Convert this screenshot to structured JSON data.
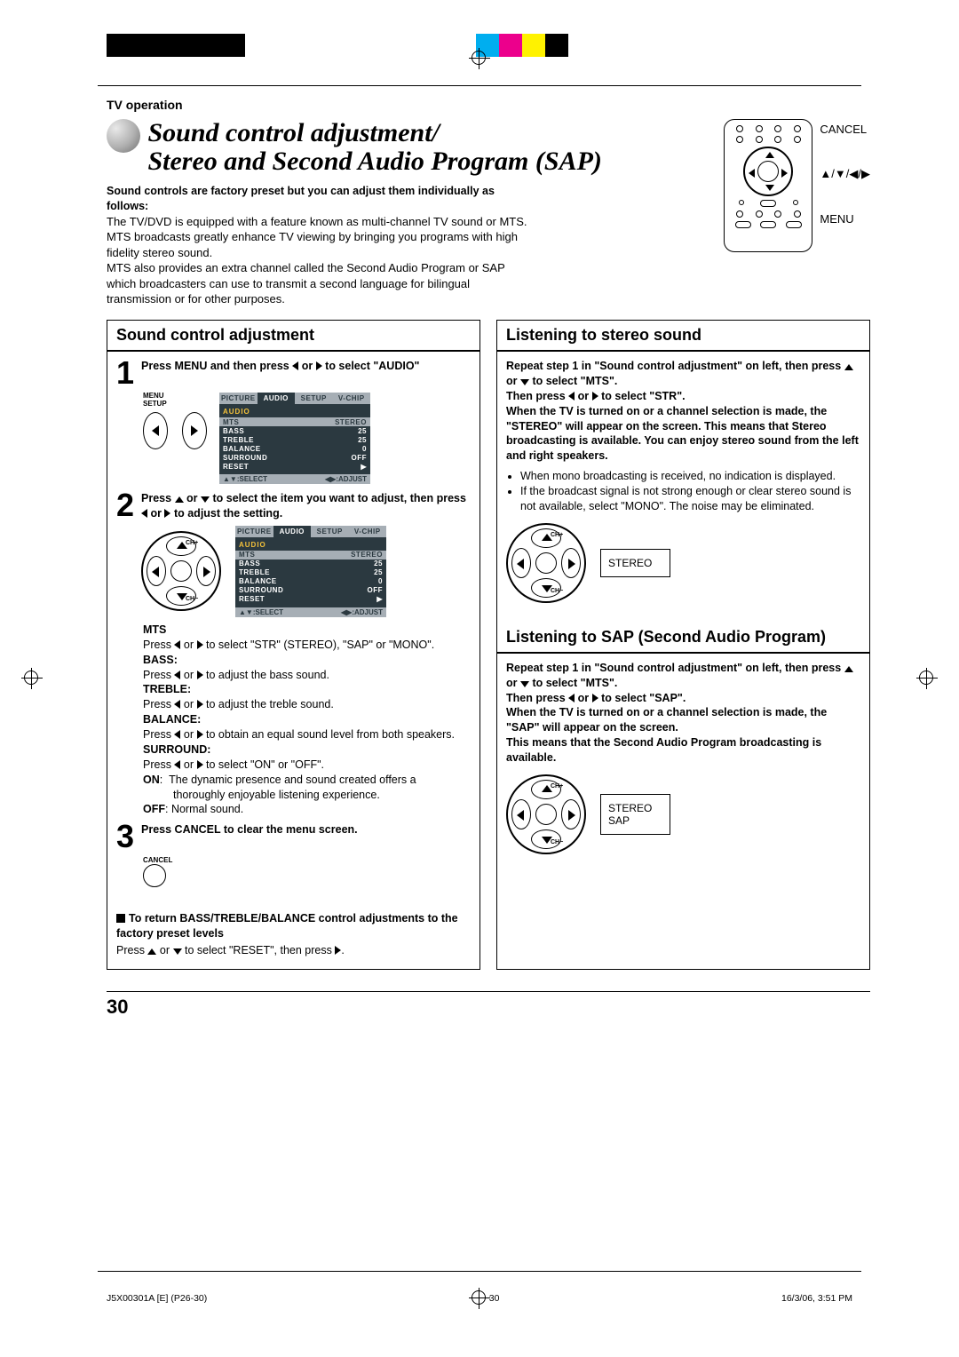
{
  "colorbar": [
    "#000",
    "#000",
    "#000",
    "#000",
    "#000",
    "#000"
  ],
  "colorbar2": [
    "#00aeef",
    "#ec008c",
    "#fff200",
    "#000000"
  ],
  "section_header": "TV operation",
  "title_line1": "Sound control adjustment/",
  "title_line2": "Stereo and Second Audio Program (SAP)",
  "remote_labels": {
    "cancel": "CANCEL",
    "arrows": "▲/▼/◀/▶",
    "menu": "MENU"
  },
  "intro_lead": "Sound controls are factory preset but you can adjust them individually as follows:",
  "intro_body": "The TV/DVD is equipped with a feature known as multi-channel TV sound or MTS. MTS broadcasts greatly enhance TV viewing by bringing you programs with high fidelity stereo sound.\nMTS also provides an extra channel called the Second Audio Program or SAP which broadcasters can use to transmit a second language for bilingual transmission or for other purposes.",
  "left": {
    "heading": "Sound control adjustment",
    "step1": "Press MENU and then press ◀ or ▶ to select \"AUDIO\"",
    "menu_setup_label": "MENU\nSETUP",
    "osd_tabs": [
      "PICTURE",
      "AUDIO",
      "SETUP",
      "V-CHIP"
    ],
    "osd_title": "AUDIO",
    "osd_rows": [
      {
        "k": "MTS",
        "v": "STEREO"
      },
      {
        "k": "BASS",
        "v": "25"
      },
      {
        "k": "TREBLE",
        "v": "25"
      },
      {
        "k": "BALANCE",
        "v": "0"
      },
      {
        "k": "SURROUND",
        "v": "OFF"
      },
      {
        "k": "RESET",
        "v": "▶"
      }
    ],
    "osd_footer": {
      "l": "▲▼:SELECT",
      "r": "◀▶:ADJUST"
    },
    "step2": "Press ▲ or ▼ to select the item you want to adjust, then press ◀ or ▶ to adjust the setting.",
    "defs": {
      "mts_t": "MTS",
      "mts_b": "Press ◀ or ▶ to select \"STR\" (STEREO), \"SAP\" or \"MONO\".",
      "bass_t": "BASS:",
      "bass_b": "Press ◀ or ▶ to adjust the bass sound.",
      "treble_t": "TREBLE:",
      "treble_b": "Press ◀ or ▶ to adjust the treble sound.",
      "balance_t": "BALANCE:",
      "balance_b": "Press ◀ or ▶ to obtain an equal sound level from both speakers.",
      "surround_t": "SURROUND:",
      "surround_b": "Press ◀ or ▶ to select \"ON\" or \"OFF\".",
      "surround_on": "ON:  The dynamic presence and sound created offers a thoroughly enjoyable listening experience.",
      "surround_off": "OFF: Normal sound."
    },
    "step3": "Press CANCEL to clear the menu screen.",
    "cancel_label": "CANCEL",
    "reset_title": "To return BASS/TREBLE/BALANCE control adjustments to the factory preset levels",
    "reset_body": "Press ▲ or ▼ to select \"RESET\", then press ▶."
  },
  "right": {
    "heading1": "Listening to stereo sound",
    "para1": "Repeat step 1 in \"Sound control adjustment\" on left, then press ▲ or ▼ to select \"MTS\".\nThen press ◀ or ▶ to select \"STR\".\nWhen the TV is turned on or a channel selection is made, the \"STEREO\" will appear on the screen. This means that Stereo broadcasting is available. You can enjoy stereo sound from the left and right speakers.",
    "bullets": [
      "When mono broadcasting is received, no indication is displayed.",
      "If the broadcast signal is not strong enough or clear stereo sound is not available, select \"MONO\". The noise may be eliminated."
    ],
    "osd_label1": "STEREO",
    "heading2": "Listening to SAP (Second Audio Program)",
    "para2": "Repeat step 1 in \"Sound control adjustment\" on left, then press ▲ or ▼ to select \"MTS\".\nThen press ◀ or ▶ to select \"SAP\".\nWhen the TV is turned on or a channel selection is made, the \"SAP\" will appear on the screen.\nThis means that the Second Audio Program broadcasting is available.",
    "osd_label2": "STEREO\nSAP"
  },
  "page_number": "30",
  "footer": {
    "left": "J5X00301A [E] (P26-30)",
    "center": "30",
    "right": "16/3/06, 3:51 PM"
  }
}
